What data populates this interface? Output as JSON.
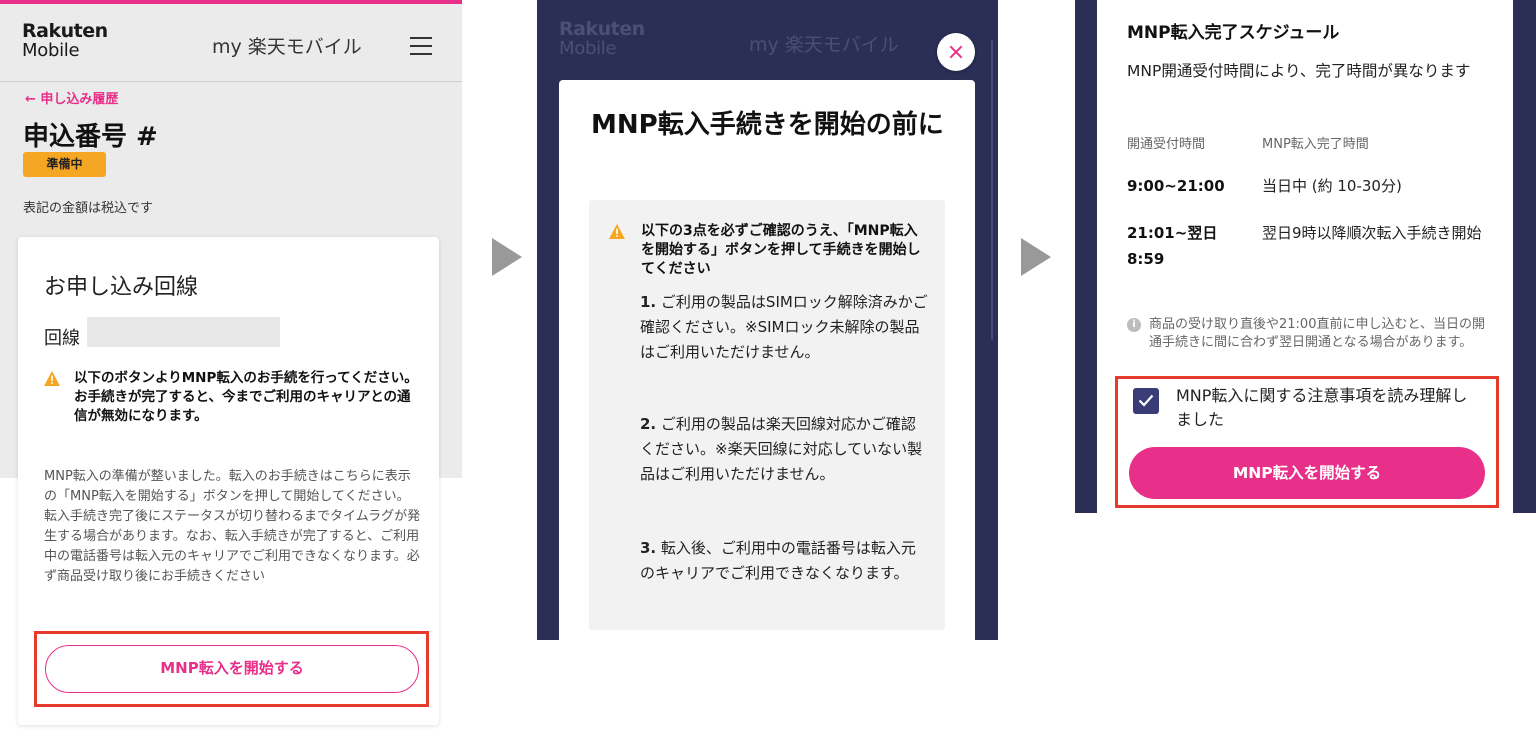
{
  "header": {
    "logo_line1": "Rakuten",
    "logo_line2": "Mobile",
    "app_title": "my 楽天モバイル"
  },
  "panel1": {
    "back_link": "← 申し込み履歴",
    "order_number": "申込番号 #",
    "status_badge": "準備中",
    "tax_note": "表記の金額は税込です",
    "card_title": "お申し込み回線",
    "line_label": "回線",
    "warning": "以下のボタンよりMNP転入のお手続を行ってください。お手続きが完了すると、今までご利用のキャリアとの通信が無効になります。",
    "description": "MNP転入の準備が整いました。転入のお手続きはこちらに表示の「MNP転入を開始する」ボタンを押して開始してください。転入手続き完了後にステータスが切り替わるまでタイムラグが発生する場合があります。なお、転入手続きが完了すると、ご利用中の電話番号は転入元のキャリアでご利用できなくなります。必ず商品受け取り後にお手続きください",
    "button_label": "MNP転入を開始する"
  },
  "panel2": {
    "modal_title": "MNP転入手続きを開始の前に",
    "warning": "以下の3点を必ずご確認のうえ、「MNP転入を開始する」ボタンを押して手続きを開始してください",
    "items": [
      {
        "num": "1.",
        "text": "ご利用の製品はSIMロック解除済みかご確認ください。※SIMロック未解除の製品はご利用いただけません。"
      },
      {
        "num": "2.",
        "text": "ご利用の製品は楽天回線対応かご確認ください。※楽天回線に対応していない製品はご利用いただけません。"
      },
      {
        "num": "3.",
        "text": "転入後、ご利用中の電話番号は転入元のキャリアでご利用できなくなります。"
      }
    ]
  },
  "panel3": {
    "schedule_title": "MNP転入完了スケジュール",
    "schedule_desc": "MNP開通受付時間により、完了時間が異なります",
    "col_reception": "開通受付時間",
    "col_completion": "MNP転入完了時間",
    "rows": [
      {
        "time": "9:00~21:00",
        "result": "当日中 (約 10-30分)"
      },
      {
        "time": "21:01~翌日8:59",
        "result": "翌日9時以降順次転入手続き開始"
      }
    ],
    "note": "商品の受け取り直後や21:00直前に申し込むと、当日の開通手続きに間に合わず翌日開通となる場合があります。",
    "checkbox_label": "MNP転入に関する注意事項を読み理解しました",
    "checkbox_checked": true,
    "button_label": "MNP転入を開始する"
  },
  "colors": {
    "brand_pink": "#e8308a",
    "status_yellow": "#f5a623",
    "highlight_red": "#e53a2c",
    "overlay_navy": "#2b2e55"
  }
}
